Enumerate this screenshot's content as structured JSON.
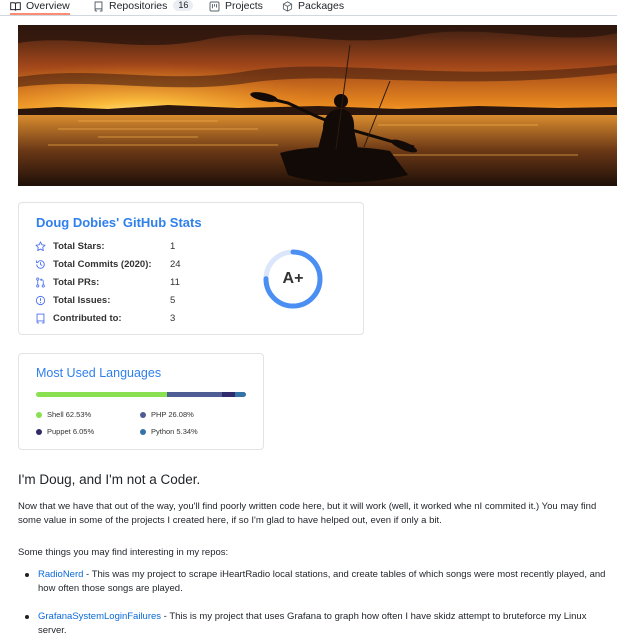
{
  "tabs": [
    {
      "label": "Overview",
      "icon": "book-icon"
    },
    {
      "label": "Repositories",
      "icon": "repo-icon",
      "count": "16"
    },
    {
      "label": "Projects",
      "icon": "project-icon"
    },
    {
      "label": "Packages",
      "icon": "package-icon"
    }
  ],
  "stats": {
    "title": "Doug Dobies' GitHub Stats",
    "rows": [
      {
        "label": "Total Stars:",
        "value": "1",
        "icon": "star-icon"
      },
      {
        "label": "Total Commits (2020):",
        "value": "24",
        "icon": "history-icon"
      },
      {
        "label": "Total PRs:",
        "value": "11",
        "icon": "pull-request-icon"
      },
      {
        "label": "Total Issues:",
        "value": "5",
        "icon": "issue-icon"
      },
      {
        "label": "Contributed to:",
        "value": "3",
        "icon": "repo-icon"
      }
    ],
    "grade": "A+",
    "grade_progress": 0.75,
    "accent": "#2f80ed"
  },
  "languages": {
    "title": "Most Used Languages",
    "items": [
      {
        "name": "Shell 62.53%",
        "percent": 62.53,
        "color": "#89e051"
      },
      {
        "name": "PHP 26.08%",
        "percent": 26.08,
        "color": "#4f5d95"
      },
      {
        "name": "Puppet 6.05%",
        "percent": 6.05,
        "color": "#302b6d"
      },
      {
        "name": "Python 5.34%",
        "percent": 5.34,
        "color": "#3572a5"
      }
    ]
  },
  "readme": {
    "heading": "I'm Doug, and I'm not a Coder.",
    "intro": "Now that we have that out of the way, you'll find poorly written code here, but it will work (well, it worked whe nI commited it.) You may find some value in some of the projects I created here, if so I'm glad to have helped out, even if only a bit.",
    "things_heading": "Some things you may find interesting in my repos:",
    "items": [
      {
        "link": "RadioNerd",
        "text": " - This was my project to scrape iHeartRadio local stations, and create tables of which songs were most recently played, and how often those songs are played."
      },
      {
        "link": "GrafanaSystemLoginFailures",
        "text": " - This is my project that uses Grafana to graph how often I have skidz attempt to bruteforce my Linux server."
      }
    ]
  }
}
